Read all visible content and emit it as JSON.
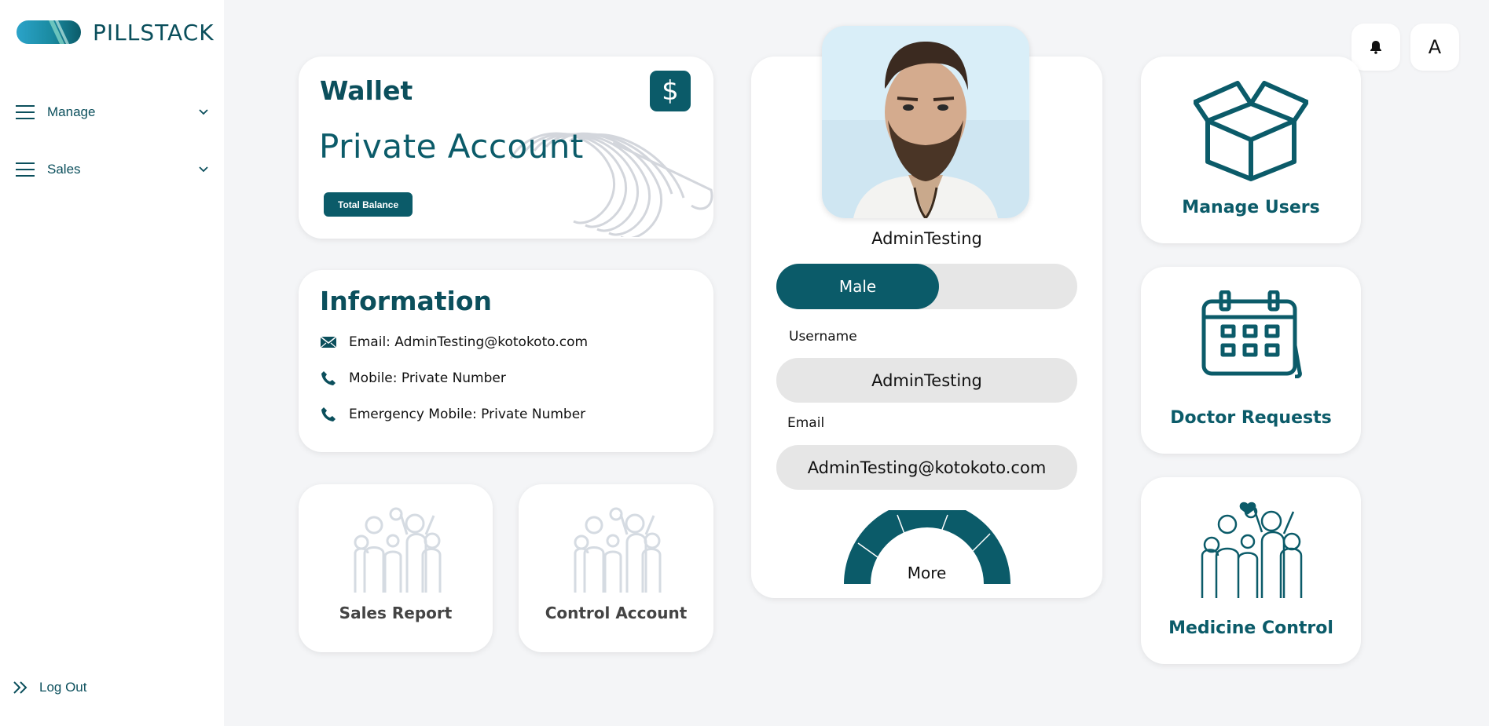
{
  "brand": {
    "name": "PILLSTACK"
  },
  "sidebar": {
    "items": [
      {
        "label": "Manage"
      },
      {
        "label": "Sales"
      }
    ],
    "logout_label": "Log Out"
  },
  "wallet": {
    "title": "Wallet",
    "account": "Private Account",
    "balance_button": "Total Balance",
    "currency_symbol": "$"
  },
  "information": {
    "title": "Information",
    "email": "Email: AdminTesting@kotokoto.com",
    "mobile": "Mobile: Private Number",
    "emergency": "Emergency Mobile: Private Number"
  },
  "tiles": {
    "sales_report": "Sales Report",
    "control_account": "Control Account"
  },
  "profile": {
    "name": "AdminTesting",
    "gender": "Male",
    "username_label": "Username",
    "username_value": "AdminTesting",
    "email_label": "Email",
    "email_value": "AdminTesting@kotokoto.com",
    "more_label": "More"
  },
  "right_cards": {
    "manage_users": "Manage Users",
    "doctor_requests": "Doctor Requests",
    "medicine_control": "Medicine Control"
  },
  "topbar": {
    "avatar_letter": "A"
  },
  "colors": {
    "primary": "#0b5b69",
    "background": "#f4f5f7",
    "card": "#ffffff",
    "field": "#e6e6e6"
  }
}
